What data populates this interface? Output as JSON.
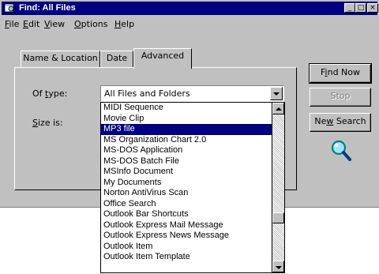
{
  "window": {
    "title": "Find: All Files",
    "controls": {
      "minimize": "_",
      "maximize": "□",
      "close": "×"
    }
  },
  "menu": [
    {
      "label": "File",
      "accel": "F",
      "rest": "ile"
    },
    {
      "label": "Edit",
      "accel": "E",
      "rest": "dit"
    },
    {
      "label": "View",
      "accel": "V",
      "rest": "iew"
    },
    {
      "label": "Options",
      "accel": "O",
      "rest": "ptions"
    },
    {
      "label": "Help",
      "accel": "H",
      "rest": "elp"
    }
  ],
  "tabs": {
    "name_location": "Name & Location",
    "date": "Date",
    "advanced": "Advanced"
  },
  "form": {
    "of_type_pre": "Of ",
    "of_type_accel": "t",
    "of_type_post": "ype:",
    "size_accel": "S",
    "size_post": "ize is:",
    "type_value": "All Files and Folders"
  },
  "dropdown": {
    "items": [
      "MIDI Sequence",
      "Movie Clip",
      "MP3 file",
      "MS Organization Chart 2.0",
      "MS-DOS Application",
      "MS-DOS Batch File",
      "MSInfo Document",
      "My Documents",
      "Norton AntiVirus Scan",
      "Office Search",
      "Outlook Bar Shortcuts",
      "Outlook Express Mail Message",
      "Outlook Express News Message",
      "Outlook Item",
      "Outlook Item Template"
    ],
    "selected": "MP3 file"
  },
  "buttons": {
    "find_now_pre": "F",
    "find_now_accel": "i",
    "find_now_post": "nd Now",
    "stop": "Stop",
    "new_search_pre": "Ne",
    "new_search_accel": "w",
    "new_search_post": " Search"
  },
  "icons": {
    "title_icon": "find-window-icon",
    "animation": "magnifier-icon"
  }
}
